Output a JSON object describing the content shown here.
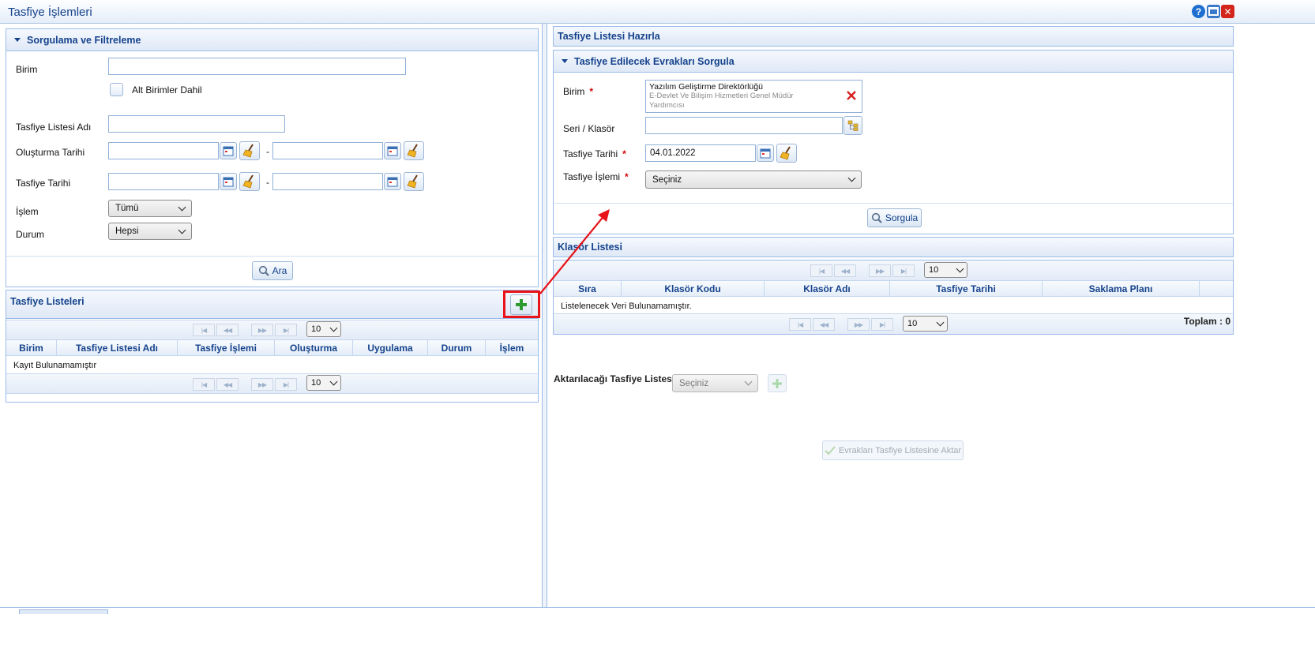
{
  "window": {
    "title": "Tasfiye İşlemleri"
  },
  "filter": {
    "title": "Sorgulama ve Filtreleme",
    "birim_label": "Birim",
    "birim_value": "",
    "alt_birimler_label": "Alt Birimler Dahil",
    "liste_adi_label": "Tasfiye Listesi Adı",
    "olusturma_label": "Oluşturma Tarihi",
    "tasfiye_tarihi_label": "Tasfiye Tarihi",
    "range_dash": "-",
    "islem_label": "İşlem",
    "islem_value": "Tümü",
    "durum_label": "Durum",
    "durum_value": "Hepsi",
    "search_button": "Ara"
  },
  "lists": {
    "title": "Tasfiye Listeleri",
    "page_size": "10",
    "columns": [
      "Birim",
      "Tasfiye Listesi Adı",
      "Tasfiye İşlemi",
      "Oluşturma",
      "Uygulama",
      "Durum",
      "İşlem"
    ],
    "empty_text": "Kayıt Bulunamamıştır"
  },
  "prepare": {
    "title": "Tasfiye Listesi Hazırla",
    "query_title": "Tasfiye Edilecek Evrakları Sorgula",
    "birim_label": "Birim",
    "required_mark": "*",
    "birim_value_line1": "Yazılım Geliştirme Direktörlüğü",
    "birim_value_line2": "E-Devlet Ve Bilişim Hizmetleri Genel Müdür",
    "birim_value_line3": "Yardımcısı",
    "seri_label": "Seri / Klasör",
    "tarih_label": "Tasfiye Tarihi",
    "tarih_value": "04.01.2022",
    "islem_label": "Tasfiye İşlemi",
    "islem_value": "Seçiniz",
    "query_button": "Sorgula"
  },
  "folders": {
    "title": "Klasör Listesi",
    "page_size": "10",
    "columns": [
      "Sıra",
      "Klasör Kodu",
      "Klasör Adı",
      "Tasfiye Tarihi",
      "Saklama Planı"
    ],
    "empty_text": "Listelenecek Veri Bulunamamıştır.",
    "total_text": "Toplam : 0"
  },
  "transfer": {
    "label": "Aktarılacağı Tasfiye Listesi",
    "select_value": "Seçiniz",
    "button": "Evrakları Tasfiye Listesine Aktar"
  },
  "colors": {
    "header_text": "#15428b",
    "border": "#99bbe8",
    "annotation": "#e8141a",
    "add_green": "#2e9b2e"
  }
}
